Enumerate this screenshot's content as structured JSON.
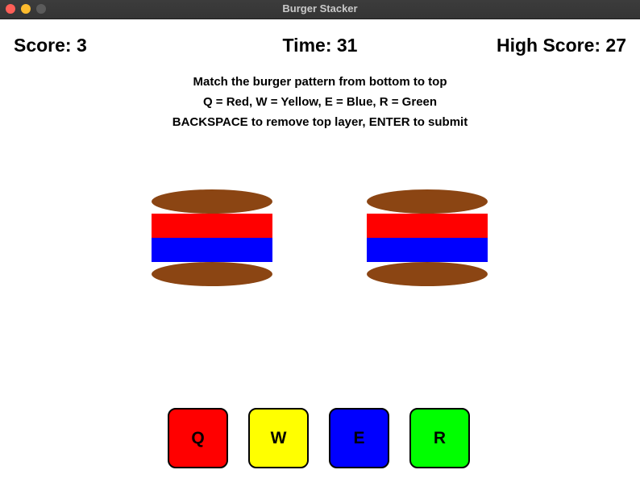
{
  "window": {
    "title": "Burger Stacker"
  },
  "hud": {
    "score_text": "Score: 3",
    "time_text": "Time: 31",
    "high_score_text": "High Score: 27"
  },
  "instructions": [
    "Match the burger pattern from bottom to top",
    "Q = Red, W = Yellow, E = Blue, R = Green",
    "BACKSPACE to remove top layer, ENTER to submit"
  ],
  "colors": {
    "bun": "#8b4513",
    "red": "#ff0000",
    "yellow": "#ffff00",
    "blue": "#0000ff",
    "green": "#00ff00"
  },
  "target_burger": {
    "layers_bottom_to_top": [
      "blue",
      "red"
    ]
  },
  "player_burger": {
    "layers_bottom_to_top": [
      "blue",
      "red"
    ]
  },
  "key_buttons": [
    {
      "key": "Q",
      "color": "#ff0000"
    },
    {
      "key": "W",
      "color": "#ffff00"
    },
    {
      "key": "E",
      "color": "#0000ff"
    },
    {
      "key": "R",
      "color": "#00ff00"
    }
  ]
}
